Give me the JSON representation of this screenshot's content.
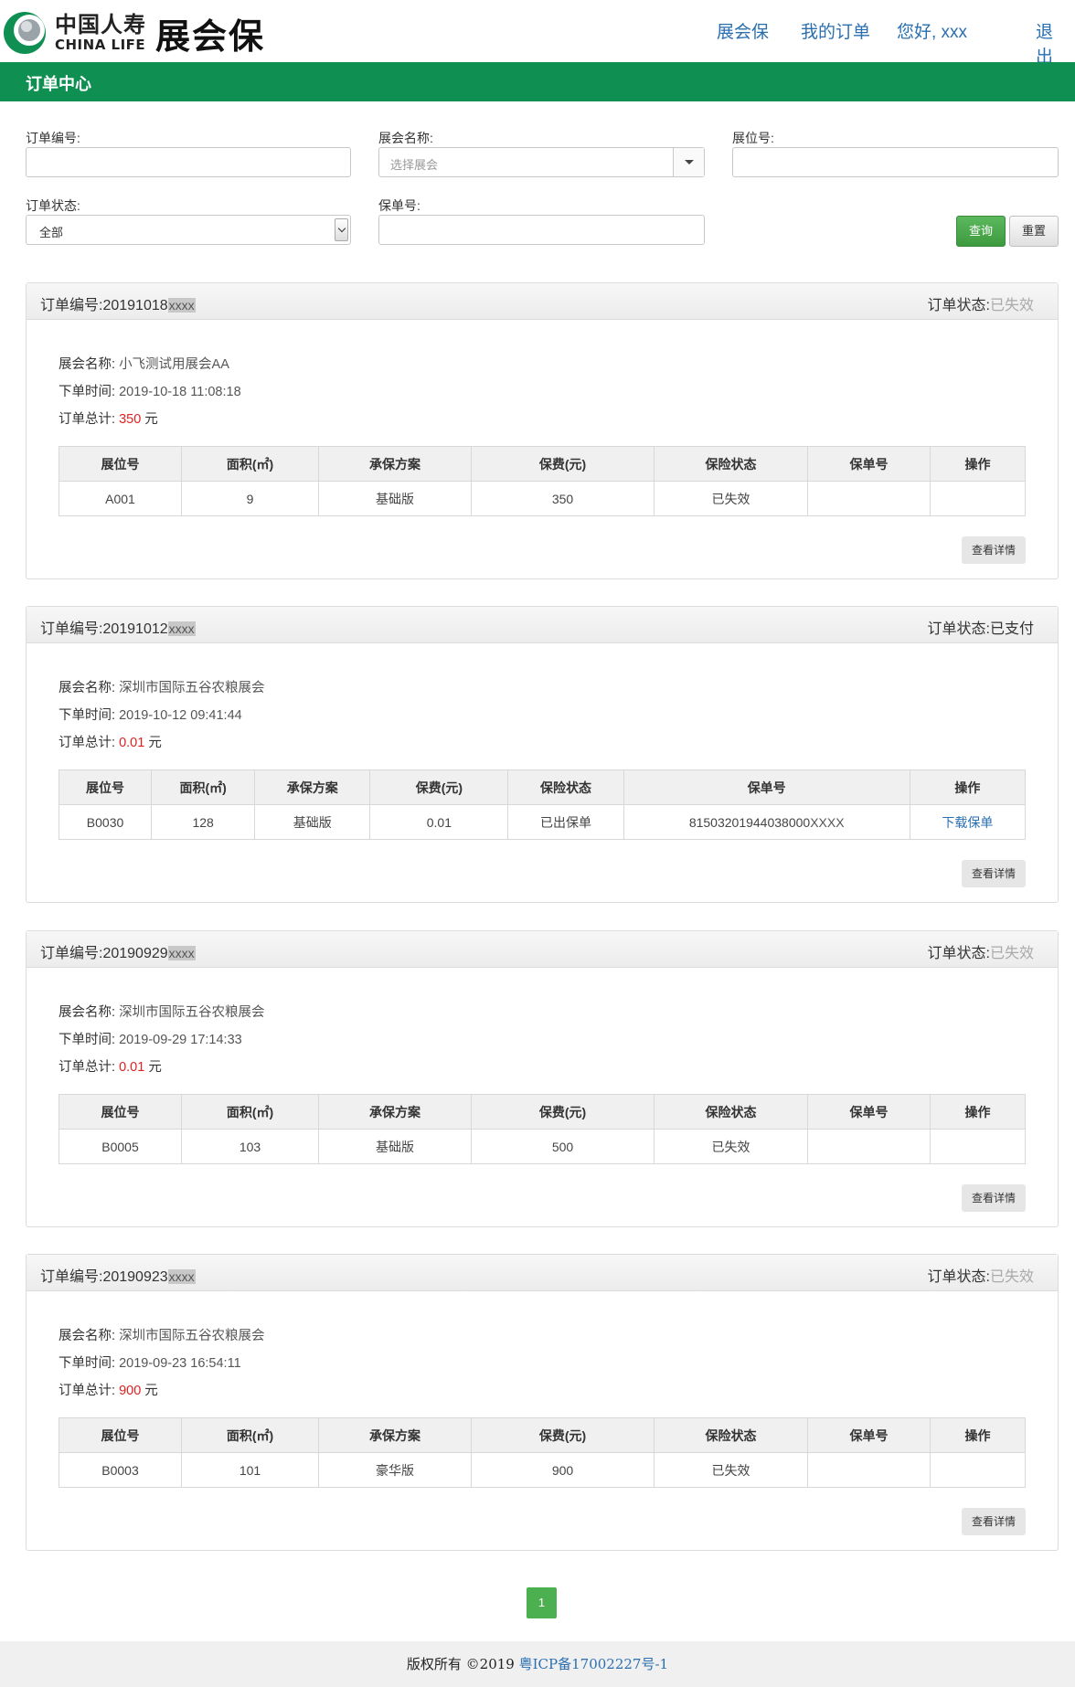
{
  "brand": {
    "cn": "中国人寿",
    "en": "CHINA LIFE",
    "product": "展会保"
  },
  "nav": {
    "expo": "展会保",
    "orders": "我的订单",
    "greeting": "您好, xxx",
    "logout": "退出"
  },
  "section_title": "订单中心",
  "filters": {
    "order_no_label": "订单编号:",
    "expo_name_label": "展会名称:",
    "expo_name_placeholder": "选择展会",
    "booth_label": "展位号:",
    "status_label": "订单状态:",
    "status_value": "全部",
    "policy_label": "保单号:",
    "query_button": "查询",
    "reset_button": "重置"
  },
  "labels": {
    "order_no": "订单编号:",
    "order_status": "订单状态:",
    "expo_name": "展会名称:",
    "order_time": "下单时间:",
    "order_total": "订单总计:",
    "currency": "元",
    "detail_button": "查看详情"
  },
  "table_headers": [
    "展位号",
    "面积(㎡)",
    "承保方案",
    "保费(元)",
    "保险状态",
    "保单号",
    "操作"
  ],
  "orders": [
    {
      "order_no": "20191018",
      "order_no_mask": "xxxx",
      "status": "已失效",
      "expo": "小飞测试用展会AA",
      "time": "2019-10-18 11:08:18",
      "total": "350",
      "row": {
        "booth": "A001",
        "area": "9",
        "plan": "基础版",
        "premium": "350",
        "ins_status": "已失效",
        "policy_no": "",
        "policy_mask": "",
        "action": ""
      }
    },
    {
      "order_no": "20191012",
      "order_no_mask": "xxxx",
      "status": "已支付",
      "expo": "深圳市国际五谷农粮展会",
      "time": "2019-10-12 09:41:44",
      "total": "0.01",
      "row": {
        "booth": "B0030",
        "area": "128",
        "plan": "基础版",
        "premium": "0.01",
        "ins_status": "已出保单",
        "policy_no": "81503201944038000",
        "policy_mask": "XXXX",
        "action": "下载保单"
      }
    },
    {
      "order_no": "20190929",
      "order_no_mask": "xxxx",
      "status": "已失效",
      "expo": "深圳市国际五谷农粮展会",
      "time": "2019-09-29 17:14:33",
      "total": "0.01",
      "row": {
        "booth": "B0005",
        "area": "103",
        "plan": "基础版",
        "premium": "500",
        "ins_status": "已失效",
        "policy_no": "",
        "policy_mask": "",
        "action": ""
      }
    },
    {
      "order_no": "20190923",
      "order_no_mask": "xxxx",
      "status": "已失效",
      "expo": "深圳市国际五谷农粮展会",
      "time": "2019-09-23 16:54:11",
      "total": "900",
      "row": {
        "booth": "B0003",
        "area": "101",
        "plan": "豪华版",
        "premium": "900",
        "ins_status": "已失效",
        "policy_no": "",
        "policy_mask": "",
        "action": ""
      }
    }
  ],
  "pagination": {
    "current": "1"
  },
  "footer": {
    "copyright": "版权所有 ©2019 ",
    "icp": "粤ICP备17002227号-1"
  },
  "colors": {
    "brand_green": "#0f9052",
    "link_blue": "#2a6fb0",
    "price_red": "#e02020",
    "expired_gray": "#aaaaaa"
  }
}
